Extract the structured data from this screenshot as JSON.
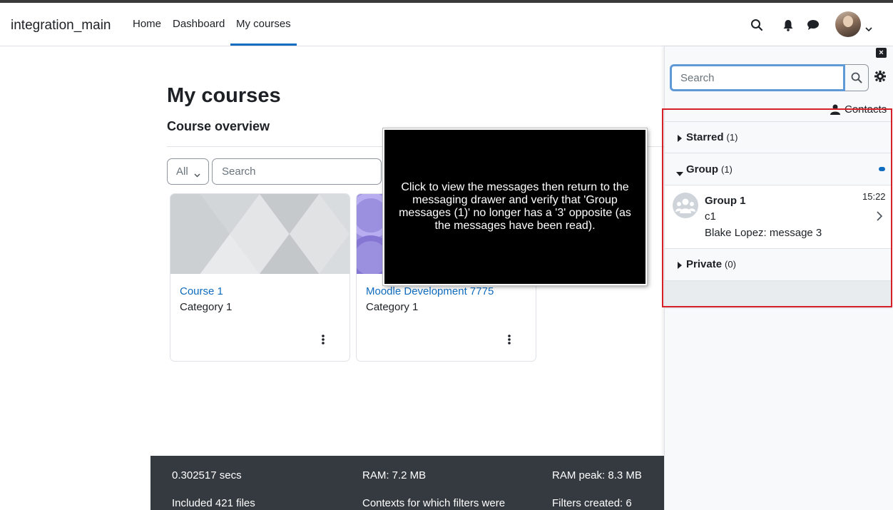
{
  "navbar": {
    "site_name": "integration_main",
    "links": [
      "Home",
      "Dashboard",
      "My courses"
    ],
    "active_link": "My courses"
  },
  "main": {
    "page_title": "My courses",
    "section_title": "Course overview",
    "filter_value": "All",
    "search_placeholder": "Search",
    "courses": [
      {
        "name": "Course 1",
        "category": "Category 1"
      },
      {
        "name": "Moodle Development 7775",
        "category": "Category 1"
      }
    ]
  },
  "tooltip": {
    "text": "Click to view the messages then return to the messaging drawer and verify that 'Group messages (1)' no longer has a '3' opposite (as the messages have been read)."
  },
  "footer": {
    "items": [
      "0.302517 secs",
      "RAM: 7.2 MB",
      "RAM peak: 8.3 MB",
      "Included 421 files",
      "Contexts for which filters were",
      "Filters created: 6"
    ]
  },
  "drawer": {
    "search_placeholder": "Search",
    "contacts_label": "Contacts",
    "sections": [
      {
        "label": "Starred",
        "count": "(1)"
      },
      {
        "label": "Group",
        "count": "(1)"
      },
      {
        "label": "Private",
        "count": "(0)"
      }
    ],
    "conversation": {
      "name": "Group 1",
      "subtitle": "c1",
      "last_message": "Blake Lopez: message 3",
      "time": "15:22"
    }
  },
  "colors": {
    "accent": "#0f6cbf",
    "highlight": "#d61f26",
    "footer_bg": "#343a40"
  }
}
